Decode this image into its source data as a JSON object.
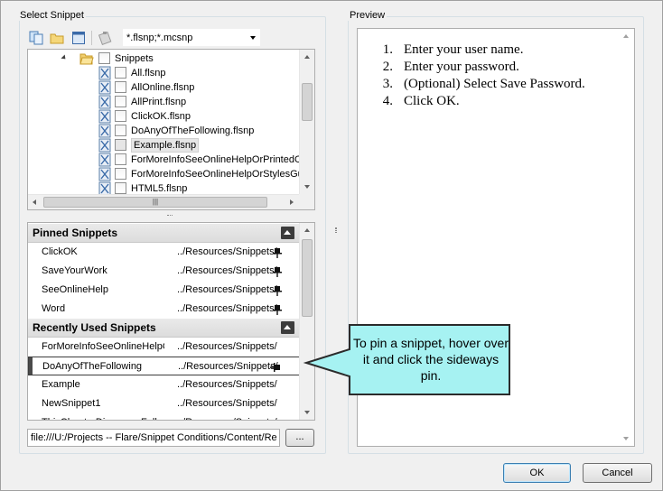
{
  "select_snippet": {
    "group_title": "Select Snippet",
    "toolbar": {
      "icons": [
        "copy-icon",
        "folder-icon",
        "window-icon",
        "paste-icon"
      ],
      "filter_value": "*.flsnp;*.mcsnp"
    },
    "tree": {
      "root_label": "Snippets",
      "items": [
        "All.flsnp",
        "AllOnline.flsnp",
        "AllPrint.flsnp",
        "ClickOK.flsnp",
        "DoAnyOfTheFollowing.flsnp",
        "Example.flsnp",
        "ForMoreInfoSeeOnlineHelpOrPrintedOu",
        "ForMoreInfoSeeOnlineHelpOrStylesGuid",
        "HTML5.flsnp"
      ],
      "selected_index": 5,
      "hscroll_grip": "|||"
    },
    "pinned": {
      "header": "Pinned Snippets",
      "rows": [
        {
          "name": "ClickOK",
          "path": "../Resources/Snippets/"
        },
        {
          "name": "SaveYourWork",
          "path": "../Resources/Snippets/"
        },
        {
          "name": "SeeOnlineHelp",
          "path": "../Resources/Snippets/"
        },
        {
          "name": "Word",
          "path": "../Resources/Snippets/"
        }
      ]
    },
    "recent": {
      "header": "Recently Used Snippets",
      "rows": [
        {
          "name": "ForMoreInfoSeeOnlineHelpOr",
          "path": "../Resources/Snippets/"
        },
        {
          "name": "DoAnyOfTheFollowing",
          "path": "../Resources/Snippets/"
        },
        {
          "name": "Example",
          "path": "../Resources/Snippets/"
        },
        {
          "name": "NewSnippet1",
          "path": "../Resources/Snippets/"
        },
        {
          "name": "ThisChapterDiscussesFollowi",
          "path": "../Resources/Snippets/"
        }
      ],
      "hovered_index": 1
    },
    "path_value": "file:///U:/Projects -- Flare/Snippet Conditions/Content/Re",
    "browse_label": "..."
  },
  "preview": {
    "group_title": "Preview",
    "steps": [
      {
        "num": "1.",
        "text": "Enter your user name."
      },
      {
        "num": "2.",
        "text": "Enter your password."
      },
      {
        "num": "3.",
        "text": "(Optional) Select Save Password."
      },
      {
        "num": "4.",
        "text": "Click OK."
      }
    ]
  },
  "callout": {
    "text": "To pin a snippet, hover over it and click the sideways pin.",
    "fill_color": "#a6f2f2",
    "border_color": "#2b2b2b"
  },
  "footer": {
    "ok_label": "OK",
    "cancel_label": "Cancel"
  }
}
